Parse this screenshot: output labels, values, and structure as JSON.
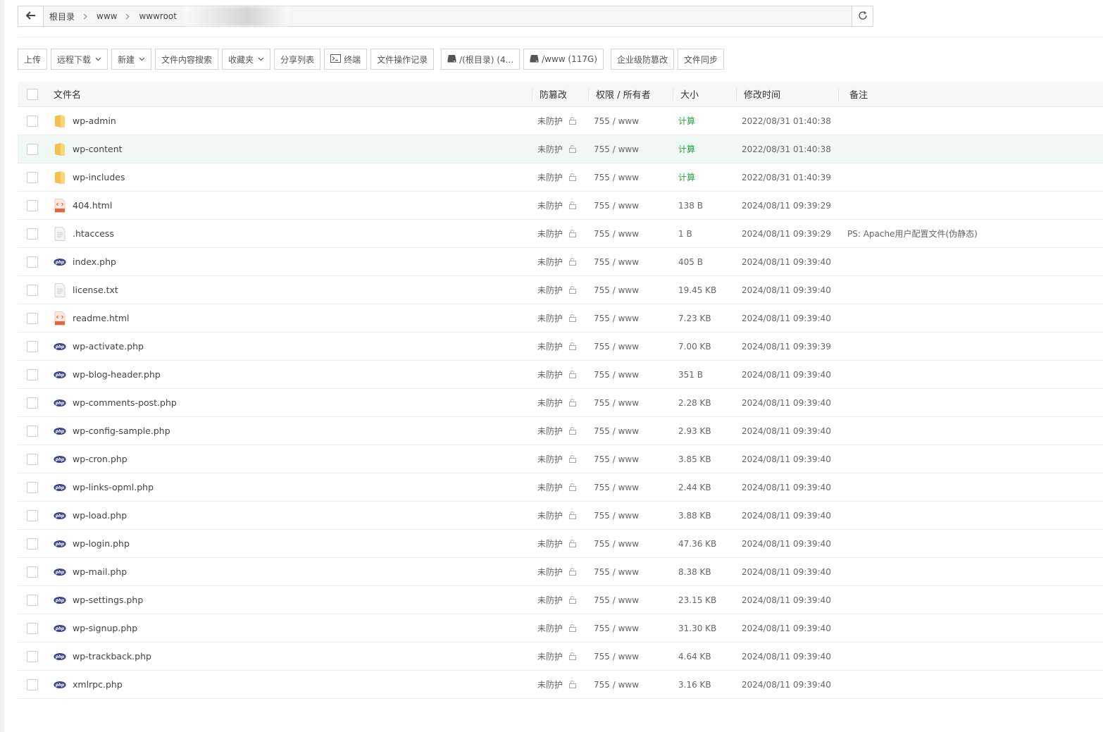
{
  "breadcrumb": {
    "items": [
      "根目录",
      "www",
      "wwwroot"
    ]
  },
  "toolbar": {
    "buttons": [
      {
        "label": "上传"
      },
      {
        "label": "远程下载"
      },
      {
        "label": "新建"
      },
      {
        "label": "文件内容搜索"
      },
      {
        "label": "收藏夹"
      },
      {
        "label": "分享列表"
      },
      {
        "label": "终端"
      },
      {
        "label": "文件操作记录"
      },
      {
        "label": "/(根目录) (4..."
      },
      {
        "label": "/www (117G)"
      },
      {
        "label": "企业级防篡改"
      },
      {
        "label": "文件同步"
      }
    ]
  },
  "table": {
    "headers": {
      "name": "文件名",
      "protect": "防篡改",
      "perm": "权限 / 所有者",
      "size": "大小",
      "mtime": "修改时间",
      "note": "备注"
    },
    "rows": [
      {
        "name": "wp-admin",
        "type": "folder",
        "protect": "未防护",
        "perm": "755 / www",
        "size": "计算",
        "mtime": "2022/08/31 01:40:38",
        "note": ""
      },
      {
        "name": "wp-content",
        "type": "folder",
        "protect": "未防护",
        "perm": "755 / www",
        "size": "计算",
        "mtime": "2022/08/31 01:40:38",
        "note": ""
      },
      {
        "name": "wp-includes",
        "type": "folder",
        "protect": "未防护",
        "perm": "755 / www",
        "size": "计算",
        "mtime": "2022/08/31 01:40:39",
        "note": ""
      },
      {
        "name": "404.html",
        "type": "html",
        "protect": "未防护",
        "perm": "755 / www",
        "size": "138 B",
        "mtime": "2024/08/11 09:39:29",
        "note": ""
      },
      {
        "name": ".htaccess",
        "type": "text",
        "protect": "未防护",
        "perm": "755 / www",
        "size": "1 B",
        "mtime": "2024/08/11 09:39:29",
        "note": "PS: Apache用户配置文件(伪静态)"
      },
      {
        "name": "index.php",
        "type": "php",
        "protect": "未防护",
        "perm": "755 / www",
        "size": "405 B",
        "mtime": "2024/08/11 09:39:40",
        "note": ""
      },
      {
        "name": "license.txt",
        "type": "text",
        "protect": "未防护",
        "perm": "755 / www",
        "size": "19.45 KB",
        "mtime": "2024/08/11 09:39:40",
        "note": ""
      },
      {
        "name": "readme.html",
        "type": "html",
        "protect": "未防护",
        "perm": "755 / www",
        "size": "7.23 KB",
        "mtime": "2024/08/11 09:39:40",
        "note": ""
      },
      {
        "name": "wp-activate.php",
        "type": "php",
        "protect": "未防护",
        "perm": "755 / www",
        "size": "7.00 KB",
        "mtime": "2024/08/11 09:39:39",
        "note": ""
      },
      {
        "name": "wp-blog-header.php",
        "type": "php",
        "protect": "未防护",
        "perm": "755 / www",
        "size": "351 B",
        "mtime": "2024/08/11 09:39:40",
        "note": ""
      },
      {
        "name": "wp-comments-post.php",
        "type": "php",
        "protect": "未防护",
        "perm": "755 / www",
        "size": "2.28 KB",
        "mtime": "2024/08/11 09:39:40",
        "note": ""
      },
      {
        "name": "wp-config-sample.php",
        "type": "php",
        "protect": "未防护",
        "perm": "755 / www",
        "size": "2.93 KB",
        "mtime": "2024/08/11 09:39:40",
        "note": ""
      },
      {
        "name": "wp-cron.php",
        "type": "php",
        "protect": "未防护",
        "perm": "755 / www",
        "size": "3.85 KB",
        "mtime": "2024/08/11 09:39:40",
        "note": ""
      },
      {
        "name": "wp-links-opml.php",
        "type": "php",
        "protect": "未防护",
        "perm": "755 / www",
        "size": "2.44 KB",
        "mtime": "2024/08/11 09:39:40",
        "note": ""
      },
      {
        "name": "wp-load.php",
        "type": "php",
        "protect": "未防护",
        "perm": "755 / www",
        "size": "3.88 KB",
        "mtime": "2024/08/11 09:39:40",
        "note": ""
      },
      {
        "name": "wp-login.php",
        "type": "php",
        "protect": "未防护",
        "perm": "755 / www",
        "size": "47.36 KB",
        "mtime": "2024/08/11 09:39:40",
        "note": ""
      },
      {
        "name": "wp-mail.php",
        "type": "php",
        "protect": "未防护",
        "perm": "755 / www",
        "size": "8.38 KB",
        "mtime": "2024/08/11 09:39:40",
        "note": ""
      },
      {
        "name": "wp-settings.php",
        "type": "php",
        "protect": "未防护",
        "perm": "755 / www",
        "size": "23.15 KB",
        "mtime": "2024/08/11 09:39:40",
        "note": ""
      },
      {
        "name": "wp-signup.php",
        "type": "php",
        "protect": "未防护",
        "perm": "755 / www",
        "size": "31.30 KB",
        "mtime": "2024/08/11 09:39:40",
        "note": ""
      },
      {
        "name": "wp-trackback.php",
        "type": "php",
        "protect": "未防护",
        "perm": "755 / www",
        "size": "4.64 KB",
        "mtime": "2024/08/11 09:39:40",
        "note": ""
      },
      {
        "name": "xmlrpc.php",
        "type": "php",
        "protect": "未防护",
        "perm": "755 / www",
        "size": "3.16 KB",
        "mtime": "2024/08/11 09:39:40",
        "note": ""
      }
    ],
    "highlighted_row": "wp-content"
  },
  "colors": {
    "calc_green": "#20a53a",
    "folder_yellow": "#f5c64a",
    "php_navy": "#3b4a8c",
    "html_orange": "#e8643c",
    "row_highlight": "#f0f8f5"
  }
}
